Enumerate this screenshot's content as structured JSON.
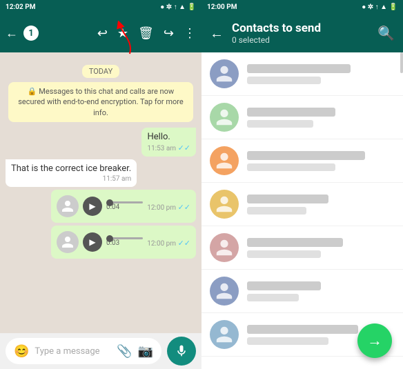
{
  "left": {
    "status_bar": {
      "time": "12:02 PM",
      "icons": "● ✲ ↑ ▲ 🔋"
    },
    "header": {
      "back_label": "←",
      "count": "1",
      "actions": [
        "↩",
        "★",
        "🗑",
        "↪",
        "⋮"
      ]
    },
    "chat": {
      "today_label": "TODAY",
      "system_msg": "🔒 Messages to this chat and calls are now secured with end-to-end encryption. Tap for more info.",
      "msg1": {
        "text": "Hello.",
        "time": "11:53 am",
        "direction": "right"
      },
      "msg2": {
        "text": "That is the correct ice breaker.",
        "time": "11:57 am",
        "direction": "left"
      },
      "voice1": {
        "duration": "0:04",
        "time": "12:00 pm"
      },
      "voice2": {
        "duration": "0:03",
        "time": "12:00 pm"
      }
    },
    "input": {
      "placeholder": "Type a message"
    }
  },
  "right": {
    "status_bar": {
      "time": "12:00 PM",
      "icons": "● ✲ ↑ ▲ 🔋"
    },
    "header": {
      "back_label": "←",
      "title": "Contacts to send",
      "subtitle": "0 selected",
      "search_label": "🔍"
    },
    "contacts": [
      {
        "id": 1,
        "name_width": "70%",
        "detail_width": "50%",
        "color": "colored-1"
      },
      {
        "id": 2,
        "name_width": "60%",
        "detail_width": "45%",
        "color": "colored-2"
      },
      {
        "id": 3,
        "name_width": "80%",
        "detail_width": "60%",
        "color": "colored-3"
      },
      {
        "id": 4,
        "name_width": "55%",
        "detail_width": "40%",
        "color": "colored-4"
      },
      {
        "id": 5,
        "name_width": "65%",
        "detail_width": "50%",
        "color": "colored-5"
      },
      {
        "id": 6,
        "name_width": "50%",
        "detail_width": "35%",
        "color": "colored-1"
      },
      {
        "id": 7,
        "name_width": "75%",
        "detail_width": "55%",
        "color": "colored-6"
      }
    ],
    "fab_label": "→"
  }
}
